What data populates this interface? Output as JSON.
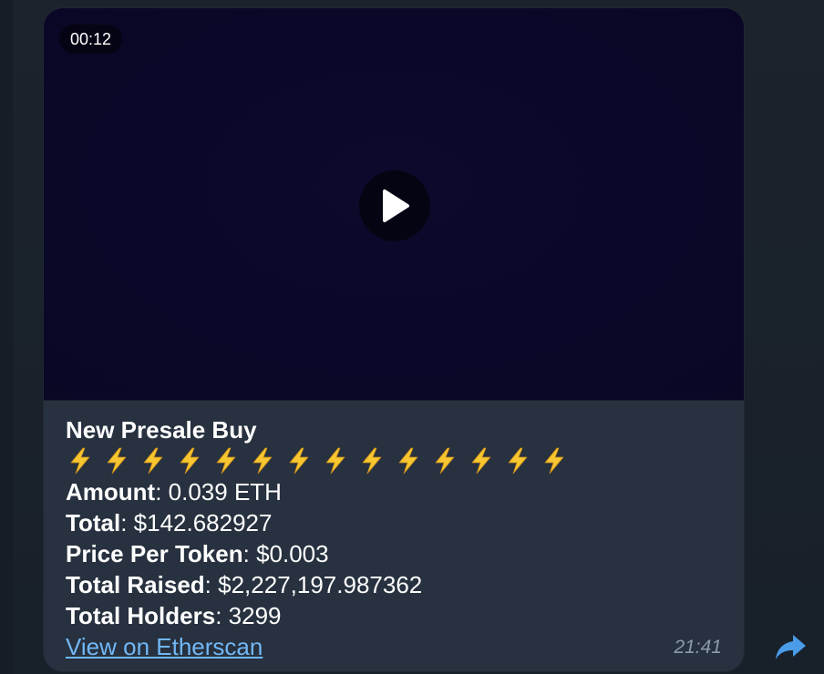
{
  "message": {
    "video": {
      "duration": "00:12"
    },
    "title": "New Presale Buy",
    "emoji_count": 14,
    "emoji_icon": "lightning-bolt-icon",
    "fields": [
      {
        "label": "Amount",
        "sep": ":",
        "value": " 0.039 ETH"
      },
      {
        "label": "Total",
        "sep": ":",
        "value": " $142.682927"
      },
      {
        "label": "Price Per Token",
        "sep": ":",
        "value": " $0.003"
      },
      {
        "label": "Total Raised",
        "sep": ":",
        "value": " $2,227,197.987362"
      },
      {
        "label": "Total Holders",
        "sep": ":",
        "value": " 3299"
      }
    ],
    "link": "View on Etherscan",
    "time": "21:41"
  },
  "colors": {
    "bubble": "#27313f",
    "link": "#71b7f5",
    "share_icon": "#4a9be8",
    "bolt": "#f7c630"
  }
}
